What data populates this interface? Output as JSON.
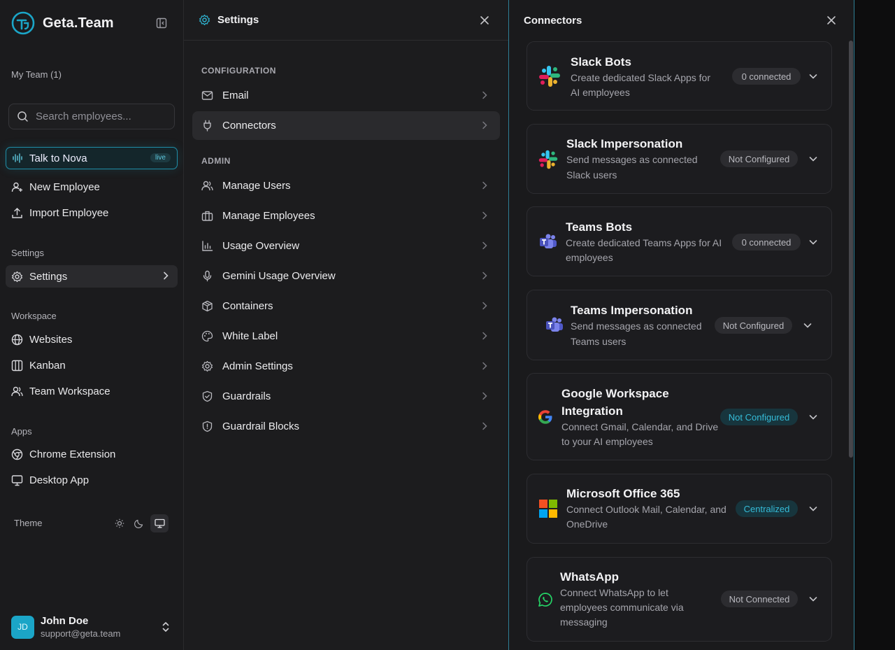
{
  "sidebar": {
    "brand": "Geta.Team",
    "team_label": "My Team (1)",
    "search_placeholder": "Search employees...",
    "nova": {
      "label": "Talk to Nova",
      "badge": "live"
    },
    "actions": [
      {
        "label": "New Employee",
        "icon": "user-plus-icon"
      },
      {
        "label": "Import Employee",
        "icon": "upload-icon"
      }
    ],
    "settings_section": "Settings",
    "settings_item": "Settings",
    "workspace_section": "Workspace",
    "workspace_items": [
      {
        "label": "Websites",
        "icon": "globe-icon"
      },
      {
        "label": "Kanban",
        "icon": "kanban-icon"
      },
      {
        "label": "Team Workspace",
        "icon": "users-icon"
      }
    ],
    "apps_section": "Apps",
    "apps_items": [
      {
        "label": "Chrome Extension",
        "icon": "chrome-icon"
      },
      {
        "label": "Desktop App",
        "icon": "monitor-icon"
      }
    ],
    "theme_label": "Theme",
    "user": {
      "initials": "JD",
      "name": "John Doe",
      "email": "support@geta.team"
    }
  },
  "settings": {
    "title": "Settings",
    "configuration_label": "CONFIGURATION",
    "configuration_items": [
      {
        "label": "Email",
        "icon": "mail-icon"
      },
      {
        "label": "Connectors",
        "icon": "plug-icon"
      }
    ],
    "admin_label": "ADMIN",
    "admin_items": [
      {
        "label": "Manage Users",
        "icon": "users-icon"
      },
      {
        "label": "Manage Employees",
        "icon": "briefcase-icon"
      },
      {
        "label": "Usage Overview",
        "icon": "bar-chart-icon"
      },
      {
        "label": "Gemini Usage Overview",
        "icon": "mic-icon"
      },
      {
        "label": "Containers",
        "icon": "box-icon"
      },
      {
        "label": "White Label",
        "icon": "palette-icon"
      },
      {
        "label": "Admin Settings",
        "icon": "gear-icon"
      },
      {
        "label": "Guardrails",
        "icon": "shield-check-icon"
      },
      {
        "label": "Guardrail Blocks",
        "icon": "shield-alert-icon"
      }
    ]
  },
  "connectors": {
    "title": "Connectors",
    "items": [
      {
        "name": "Slack Bots",
        "desc1": "Create dedicated Slack Apps for",
        "desc2": "AI employees",
        "status": "0 connected",
        "icon": "slack-icon"
      },
      {
        "name": "Slack Impersonation",
        "desc1": "Send messages as connected",
        "desc2": "Slack users",
        "status": "Not Configured",
        "icon": "slack-icon"
      },
      {
        "name": "Teams Bots",
        "desc1": "Create dedicated Teams Apps for AI",
        "desc2": "employees",
        "status": "0 connected",
        "icon": "teams-icon"
      },
      {
        "name": "Teams Impersonation",
        "desc1": "Send messages as connected",
        "desc2": "Teams users",
        "status": "Not Configured",
        "icon": "teams-icon"
      },
      {
        "name1": "Google Workspace",
        "name2": "Integration",
        "desc1": "Connect Gmail, Calendar, and Drive",
        "desc2": "to your AI employees",
        "status": "Not Configured",
        "icon": "google-icon"
      },
      {
        "name": "Microsoft Office 365",
        "desc1": "Connect Outlook Mail, Calendar, and",
        "desc2": "OneDrive",
        "status": "Centralized",
        "icon": "microsoft-icon"
      },
      {
        "name": "WhatsApp",
        "desc1": "Connect WhatsApp to let",
        "desc2": "employees communicate via",
        "desc3": "messaging",
        "status": "Not Connected",
        "icon": "whatsapp-icon"
      }
    ]
  },
  "colors": {
    "accent": "#1ba5c7",
    "badge_cyan_text": "#35bcd8",
    "background": "#1b1b1d"
  }
}
